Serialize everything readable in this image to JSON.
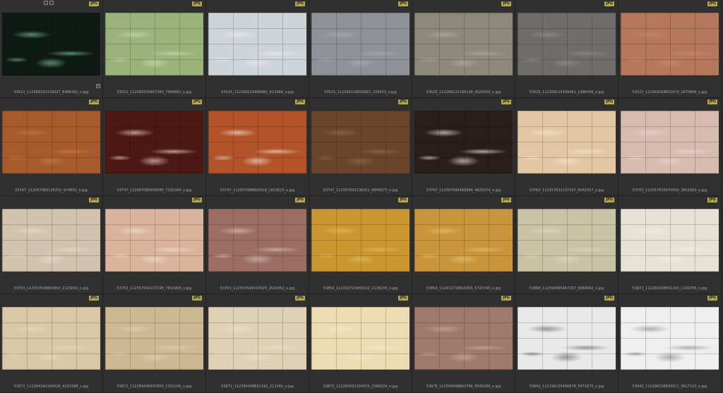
{
  "file_type_badge": "JPG",
  "toolbar_icons": [
    "select-all-icon",
    "edit-icon"
  ],
  "thumbnails": [
    {
      "name": "53512_112589332134027_6986281_o.jpg",
      "base": "#0f1a14",
      "vein": "#6fae88",
      "selected": true
    },
    {
      "name": "53512_112589335467360_7904681_o.jpg",
      "base": "#9bb27a",
      "vein": "#c7d8a6",
      "selected": false
    },
    {
      "name": "53525_112268115499482_611684_o.jpg",
      "base": "#cfd4d8",
      "vein": "#e6e9ec",
      "selected": false
    },
    {
      "name": "53525_112268118832815_228423_o.jpg",
      "base": "#8e9298",
      "vein": "#a8acb1",
      "selected": false
    },
    {
      "name": "53525_112268122166148_4024500_o.jpg",
      "base": "#8d877c",
      "vein": "#b0aa9f",
      "selected": false
    },
    {
      "name": "53525_112268125499481_1996436_o.jpg",
      "base": "#6f6d6b",
      "vein": "#8f8c88",
      "selected": false
    },
    {
      "name": "53527_112569568802670_2670956_o.jpg",
      "base": "#b5785a",
      "vein": "#c48a6c",
      "selected": false
    },
    {
      "name": "53747_112567082136252_974651_o.jpg",
      "base": "#a75a2c",
      "vein": "#c07b4c",
      "selected": false
    },
    {
      "name": "53747_112567085469585_7292394_o.jpg",
      "base": "#4e1812",
      "vein": "#d7c2b5",
      "selected": false
    },
    {
      "name": "53747_112567088802918_1823623_o.jpg",
      "base": "#b2532a",
      "vein": "#ead3bd",
      "selected": false
    },
    {
      "name": "53747_112567092136251_6845873_o.jpg",
      "base": "#6a452b",
      "vein": "#8e6a4c",
      "selected": false
    },
    {
      "name": "53747_112567095469584_4825074_o.jpg",
      "base": "#2a1e1b",
      "vein": "#d9d0c6",
      "selected": false
    },
    {
      "name": "53763_112557632137197_8032557_o.jpg",
      "base": "#e3c7a4",
      "vein": "#f3e3cf",
      "selected": false
    },
    {
      "name": "53763_112557635470530_3831663_o.jpg",
      "base": "#d8bbaf",
      "vein": "#e9d5cc",
      "selected": false
    },
    {
      "name": "53763_112557638803863_2123050_o.jpg",
      "base": "#d2c2ae",
      "vein": "#e7dbcc",
      "selected": false
    },
    {
      "name": "53763_112557642137196_7602968_o.jpg",
      "base": "#d9b39b",
      "vein": "#f0dccc",
      "selected": false
    },
    {
      "name": "53763_112557645470529_2620352_o.jpg",
      "base": "#9c6e63",
      "vein": "#d2b7ae",
      "selected": false
    },
    {
      "name": "53854_112432715483022_2118235_o.jpg",
      "base": "#c9962f",
      "vein": "#e0b95a",
      "selected": false
    },
    {
      "name": "53854_112432718816355_6723740_o.jpg",
      "base": "#c9953a",
      "vein": "#e5be6c",
      "selected": false
    },
    {
      "name": "53868_112590865467207_6664992_o.jpg",
      "base": "#c9c3a6",
      "vein": "#dcd7be",
      "selected": false
    },
    {
      "name": "53872_112284338831193_1100785_o.jpg",
      "base": "#e8e2d4",
      "vein": "#f2eee5",
      "selected": false
    },
    {
      "name": "53872_112284342164526_4103398_o.jpg",
      "base": "#d9c7a7",
      "vein": "#e7d9bf",
      "selected": false
    },
    {
      "name": "53872_112284345497859_1352245_o.jpg",
      "base": "#cdb893",
      "vein": "#e0cfae",
      "selected": false
    },
    {
      "name": "53872_112284348831192_212342_o.jpg",
      "base": "#e0d0b5",
      "vein": "#ece0cc",
      "selected": false
    },
    {
      "name": "53872_112284352164525_2584024_o.jpg",
      "base": "#ecdcb2",
      "vein": "#f5eacb",
      "selected": false
    },
    {
      "name": "53878_112558408803786_8036286_o.jpg",
      "base": "#9d7a6a",
      "vein": "#c8a99a",
      "selected": false
    },
    {
      "name": "53942_112296155496678_5971670_o.jpg",
      "base": "#e9e9e9",
      "vein": "#7d7d7d",
      "selected": false
    },
    {
      "name": "53942_112296158830011_3617523_o.jpg",
      "base": "#efefef",
      "vein": "#9a9a9a",
      "selected": false
    }
  ]
}
